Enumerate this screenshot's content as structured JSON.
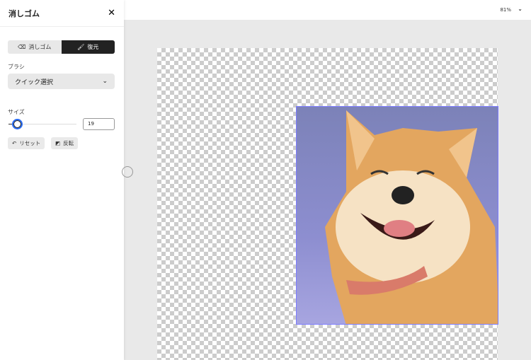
{
  "panel": {
    "title": "消しゴム",
    "close": "✕",
    "modes": {
      "erase": "消しゴム",
      "restore": "復元"
    },
    "brush_label": "ブラシ",
    "brush_value": "クイック選択",
    "size_label": "サイズ",
    "size_value": "19",
    "size_fraction": 0.12,
    "reset": "リセット",
    "invert": "反転"
  },
  "toolbar": {
    "zoom": "81%"
  }
}
